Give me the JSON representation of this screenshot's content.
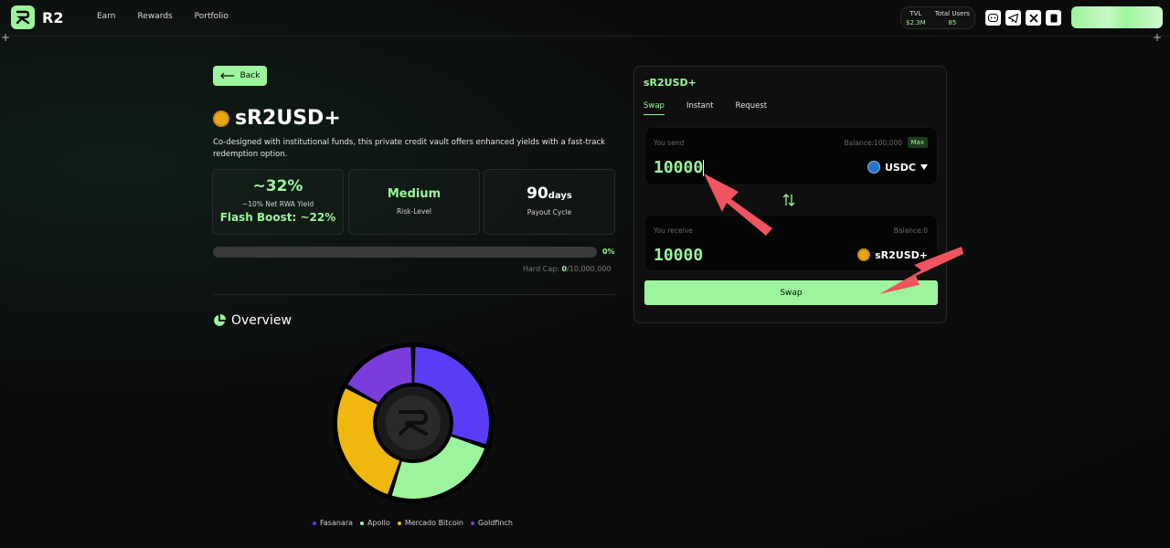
{
  "header": {
    "logo_text": "R2",
    "nav": [
      "Earn",
      "Rewards",
      "Portfolio"
    ],
    "stats": [
      {
        "label": "TVL",
        "value": "$2.3M"
      },
      {
        "label": "Total Users",
        "value": "85"
      }
    ],
    "social_icons": [
      "discord-icon",
      "telegram-icon",
      "x-icon",
      "gitbook-icon"
    ]
  },
  "vault": {
    "back_label": "Back",
    "name": "sR2USD+",
    "description": "Co-designed with institutional funds, this private credit vault offers enhanced yields with a fast-track redemption option.",
    "yield_value": "~32%",
    "yield_sub": "~10% Net RWA Yield",
    "flash_boost": "Flash Boost: ~22%",
    "risk_value": "Medium",
    "risk_label": "Risk-Level",
    "payout_number": "90",
    "payout_unit": "days",
    "payout_label": "Payout Cycle",
    "progress_fraction": 0,
    "progress_pct": "0%",
    "hardcap_prefix": "Hard Cap: ",
    "hardcap_current": "0",
    "hardcap_total": "/10,000,000"
  },
  "overview": {
    "title": "Overview",
    "allocation": [
      {
        "name": "Fasanara",
        "color": "#5b3cf5",
        "value": 30
      },
      {
        "name": "Apollo",
        "color": "#9cf59c",
        "value": 25
      },
      {
        "name": "Mercado Bitcoin",
        "color": "#f0b80f",
        "value": 28
      },
      {
        "name": "Goldfinch",
        "color": "#7a3ddb",
        "value": 17
      }
    ]
  },
  "swap_panel": {
    "title": "sR2USD+",
    "tabs": [
      "Swap",
      "Instant",
      "Request"
    ],
    "send_label": "You send",
    "send_balance": "Balance:100,000",
    "max_label": "Max",
    "send_amount": "10000",
    "send_token": "USDC",
    "receive_label": "You receive",
    "receive_balance": "Balance:0",
    "receive_amount": "10000",
    "receive_token": "sR2USD+",
    "swap_label": "Swap"
  },
  "colors": {
    "accent": "#9cf59c",
    "annotation_arrow": "#f0555f"
  }
}
